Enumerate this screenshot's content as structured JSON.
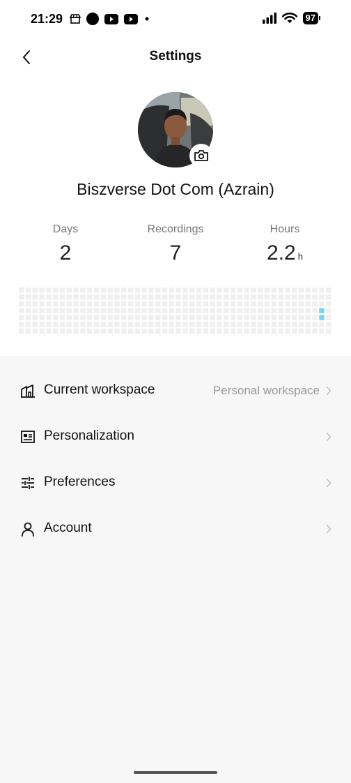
{
  "status_bar": {
    "time": "21:29",
    "battery": "97"
  },
  "header": {
    "title": "Settings"
  },
  "profile": {
    "name": "Biszverse Dot Com (Azrain)"
  },
  "stats": {
    "days": {
      "label": "Days",
      "value": "2"
    },
    "recordings": {
      "label": "Recordings",
      "value": "7"
    },
    "hours": {
      "label": "Hours",
      "value": "2.2",
      "unit": "h"
    }
  },
  "activity": {
    "columns": 46,
    "rows": 7,
    "active_cells": [
      {
        "col": 44,
        "row": 3
      },
      {
        "col": 44,
        "row": 4
      }
    ],
    "cell_color": "#efefef",
    "active_color": "#7fd3e8"
  },
  "menu": {
    "items": [
      {
        "label": "Current workspace",
        "value": "Personal workspace",
        "icon": "workspace-icon"
      },
      {
        "label": "Personalization",
        "value": "",
        "icon": "personalization-icon"
      },
      {
        "label": "Preferences",
        "value": "",
        "icon": "sliders-icon"
      },
      {
        "label": "Account",
        "value": "",
        "icon": "person-icon"
      }
    ]
  }
}
